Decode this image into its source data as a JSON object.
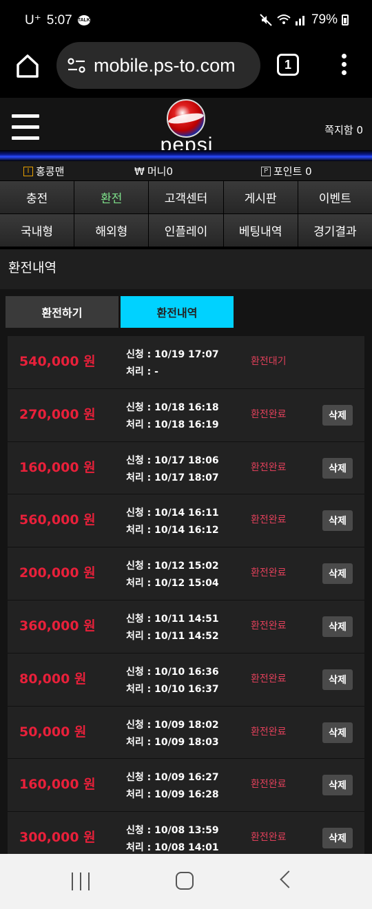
{
  "status_bar": {
    "carrier": "U⁺",
    "time": "5:07",
    "talk_badge": "TALK",
    "battery": "79%"
  },
  "browser": {
    "url": "mobile.ps-to.com",
    "tab_count": "1"
  },
  "site": {
    "logo_text": "pepsi",
    "message_box": "쪽지함 0"
  },
  "info_bar": {
    "username": "홍콩맨",
    "money": "머니0",
    "points": "포인트 0",
    "level_badge": "I",
    "money_symbol": "₩",
    "point_badge": "P"
  },
  "nav": {
    "items": [
      {
        "label": "충전",
        "active": false
      },
      {
        "label": "환전",
        "active": true
      },
      {
        "label": "고객센터",
        "active": false
      },
      {
        "label": "게시판",
        "active": false
      },
      {
        "label": "이벤트",
        "active": false
      },
      {
        "label": "국내형",
        "active": false
      },
      {
        "label": "해외형",
        "active": false
      },
      {
        "label": "인플레이",
        "active": false
      },
      {
        "label": "베팅내역",
        "active": false
      },
      {
        "label": "경기결과",
        "active": false
      }
    ]
  },
  "page": {
    "title": "환전내역",
    "tab_exchange": "환전하기",
    "tab_history": "환전내역"
  },
  "history": [
    {
      "amount": "540,000 원",
      "requested": "신청 : 10/19 17:07",
      "processed": "처리 : -",
      "status": "환전대기",
      "delete": ""
    },
    {
      "amount": "270,000 원",
      "requested": "신청 : 10/18 16:18",
      "processed": "처리 : 10/18 16:19",
      "status": "환전완료",
      "delete": "삭제"
    },
    {
      "amount": "160,000 원",
      "requested": "신청 : 10/17 18:06",
      "processed": "처리 : 10/17 18:07",
      "status": "환전완료",
      "delete": "삭제"
    },
    {
      "amount": "560,000 원",
      "requested": "신청 : 10/14 16:11",
      "processed": "처리 : 10/14 16:12",
      "status": "환전완료",
      "delete": "삭제"
    },
    {
      "amount": "200,000 원",
      "requested": "신청 : 10/12 15:02",
      "processed": "처리 : 10/12 15:04",
      "status": "환전완료",
      "delete": "삭제"
    },
    {
      "amount": "360,000 원",
      "requested": "신청 : 10/11 14:51",
      "processed": "처리 : 10/11 14:52",
      "status": "환전완료",
      "delete": "삭제"
    },
    {
      "amount": "80,000 원",
      "requested": "신청 : 10/10 16:36",
      "processed": "처리 : 10/10 16:37",
      "status": "환전완료",
      "delete": "삭제"
    },
    {
      "amount": "50,000 원",
      "requested": "신청 : 10/09 18:02",
      "processed": "처리 : 10/09 18:03",
      "status": "환전완료",
      "delete": "삭제"
    },
    {
      "amount": "160,000 원",
      "requested": "신청 : 10/09 16:27",
      "processed": "처리 : 10/09 16:28",
      "status": "환전완료",
      "delete": "삭제"
    },
    {
      "amount": "300,000 원",
      "requested": "신청 : 10/08 13:59",
      "processed": "처리 : 10/08 14:01",
      "status": "환전완료",
      "delete": "삭제"
    }
  ]
}
